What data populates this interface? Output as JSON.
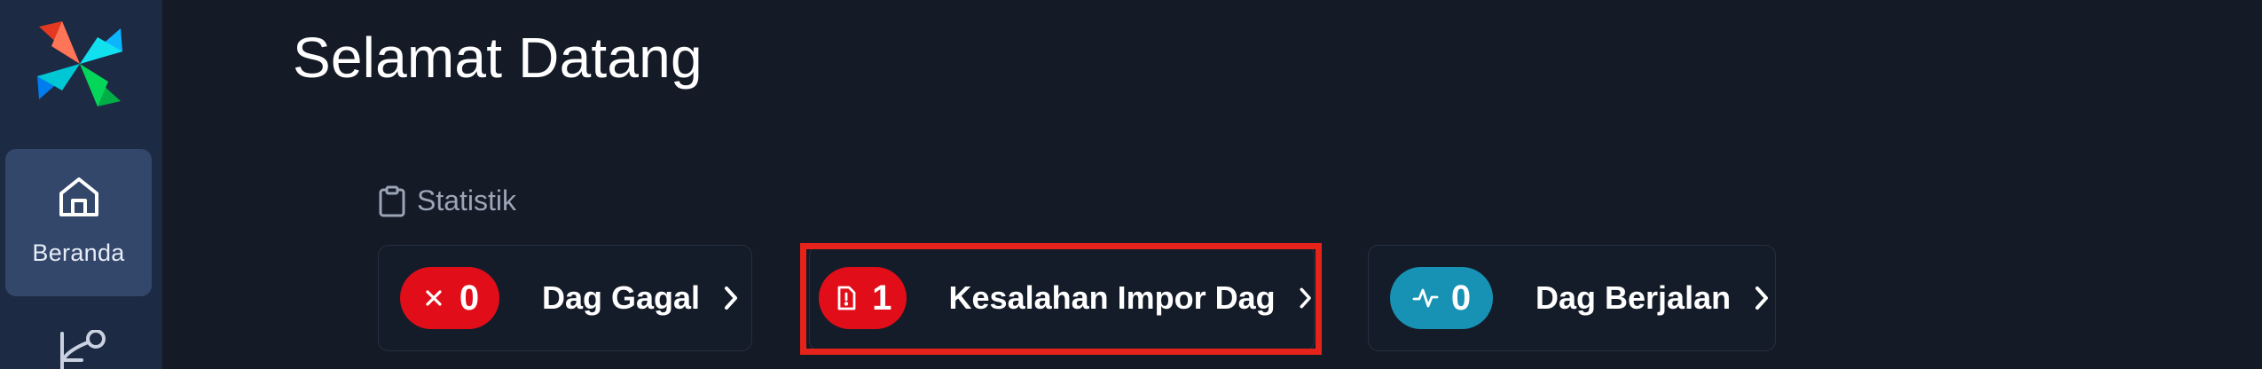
{
  "page": {
    "title": "Selamat Datang"
  },
  "sidebar": {
    "items": [
      {
        "label": "Beranda",
        "icon": "home-icon",
        "active": true
      },
      {
        "label": "",
        "icon": "dag-icon",
        "active": false
      }
    ]
  },
  "stats": {
    "section_label": "Statistik",
    "section_icon": "clipboard-icon",
    "cards": [
      {
        "count": "0",
        "label": "Dag Gagal",
        "icon": "x-icon",
        "color": "#e10e1a"
      },
      {
        "count": "1",
        "label": "Kesalahan Impor Dag",
        "icon": "alert-file-icon",
        "color": "#e10e1a",
        "highlighted": true
      },
      {
        "count": "0",
        "label": "Dag Berjalan",
        "icon": "activity-icon",
        "color": "#1792b4"
      }
    ]
  },
  "colors": {
    "sidebar_bg": "#1d2a44",
    "active_nav_bg": "#33476b",
    "page_bg": "#141a26",
    "highlight": "#e6231a"
  }
}
